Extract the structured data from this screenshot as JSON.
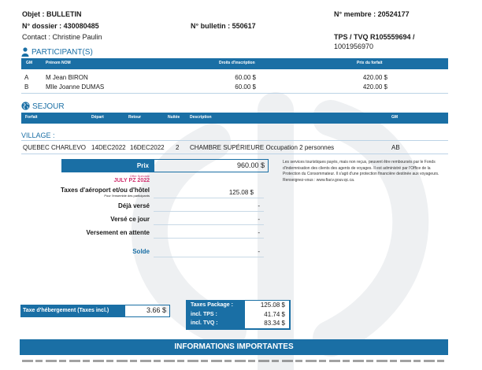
{
  "header": {
    "objet": "Objet : BULLETIN",
    "membre": "N° membre : 20524177",
    "dossier": "N° dossier : 430080485",
    "bulletin": "N° bulletin : 550617",
    "contact": "Contact : Christine Paulin",
    "tps_line1": "TPS / TVQ R105559694 /",
    "tps_line2": "1001956970"
  },
  "participants": {
    "title": "PARTICIPANT(S)",
    "columns": [
      "GM",
      "Prénom NOM",
      "Droits d'inscription",
      "Prix du forfait"
    ],
    "rows": [
      {
        "gm": "A",
        "name": "M Jean BIRON",
        "droits": "60.00 $",
        "prix": "420.00 $"
      },
      {
        "gm": "B",
        "name": "Mlle Joanne DUMAS",
        "droits": "60.00 $",
        "prix": "420.00 $"
      }
    ]
  },
  "sejour": {
    "title": "SEJOUR",
    "columns": [
      "Forfait",
      "Départ",
      "Retour",
      "Nuitée",
      "Description",
      "GM"
    ],
    "village_label": "VILLAGE :",
    "row": {
      "forfait": "QUEBEC CHARLEVO",
      "depart": "14DEC2022",
      "retour": "16DEC2022",
      "nuitee": "2",
      "description": "CHAMBRE SUPÉRIEURE  Occupation  2 personnes",
      "gm": "AB"
    }
  },
  "pricing": {
    "prix_label": "Prix",
    "prix_value": "960.00 $",
    "offre_label": "Offre Spéciale",
    "offre_value": "JULY PZ 2022",
    "taxes_label": "Taxes d'aéroport et/ou d'hôtel",
    "taxes_sub": "Pour l'ensemble des participants",
    "taxes_value": "125.08 $",
    "deja_label": "Déjà versé",
    "deja_value": "-",
    "verse_label": "Versé ce jour",
    "verse_value": "-",
    "attente_label": "Versement en attente",
    "attente_value": "-",
    "solde_label": "Solde",
    "solde_value": "-"
  },
  "notice": "Les services touristiques payés, mais non reçus, peuvent être remboursés par le Fonds d'indemnisation des clients des agents de voyages. Il est administré par l'Office de la Protection du Consommateur. Il s'agit d'une protection financière destinée aux voyageurs. Renseignez-vous : www.fiacv.gouv.qc.ca.",
  "hebergement": {
    "label": "Taxe d'hébergement (Taxes incl.)",
    "value": "3.66 $"
  },
  "taxes_box": {
    "package_label": "Taxes Package :",
    "package_value": "125.08 $",
    "tps_label": "incl. TPS :",
    "tps_value": "41.74 $",
    "tvq_label": "incl. TVQ :",
    "tvq_value": "83.34 $"
  },
  "info": {
    "title": "INFORMATIONS IMPORTANTES"
  },
  "colors": {
    "brand_blue": "#1a6fa5",
    "accent_pink": "#d0306e"
  },
  "icons": [
    "person-icon",
    "globe-icon",
    "watermark-logo"
  ]
}
